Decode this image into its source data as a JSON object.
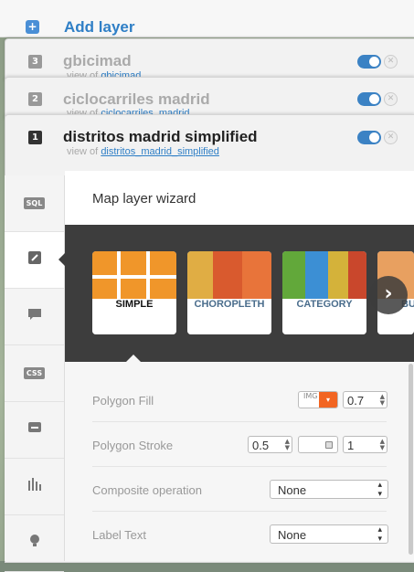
{
  "add_layer": {
    "label": "Add layer",
    "icon": "plus-icon"
  },
  "layers": [
    {
      "number": "3",
      "name": "gbicimad",
      "view_prefix": "view of",
      "view_link": "gbicimad"
    },
    {
      "number": "2",
      "name": "ciclocarriles madrid",
      "view_prefix": "view of",
      "view_link": "ciclocarriles_madrid"
    },
    {
      "number": "1",
      "name": "distritos madrid simplified",
      "view_prefix": "view of",
      "view_link": "distritos_madrid_simplified"
    }
  ],
  "sidebar": {
    "items": [
      {
        "name": "sql",
        "label": "SQL"
      },
      {
        "name": "wizard",
        "icon": "brush-icon"
      },
      {
        "name": "infowindow",
        "icon": "speech-bubble-icon"
      },
      {
        "name": "css",
        "label": "CSS"
      },
      {
        "name": "legends",
        "icon": "legend-icon"
      },
      {
        "name": "filters",
        "icon": "filter-bars-icon"
      },
      {
        "name": "mapmark",
        "icon": "lightbulb-icon"
      }
    ]
  },
  "wizard": {
    "title": "Map layer wizard",
    "types": [
      {
        "label": "SIMPLE",
        "selected": true
      },
      {
        "label": "CHOROPLETH",
        "selected": false
      },
      {
        "label": "CATEGORY",
        "selected": false
      },
      {
        "label": "BU",
        "selected": false
      }
    ],
    "next_icon": "chevron-right-icon"
  },
  "properties": {
    "polygon_fill": {
      "label": "Polygon Fill",
      "img_label": "IMG",
      "color": "#f26522",
      "opacity": "0.7"
    },
    "polygon_stroke": {
      "label": "Polygon Stroke",
      "width": "0.5",
      "opacity": "1"
    },
    "composite": {
      "label": "Composite operation",
      "value": "None"
    },
    "label_text": {
      "label": "Label Text",
      "value": "None"
    }
  }
}
